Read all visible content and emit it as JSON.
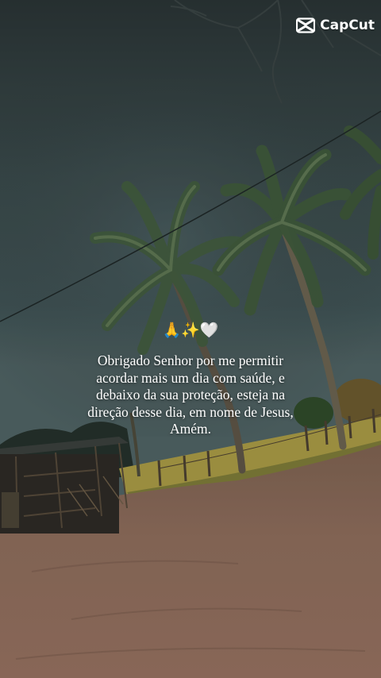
{
  "watermark": {
    "brand": "CapCut",
    "icon": "capcut-logo-icon"
  },
  "caption": {
    "emojis": "🙏✨🤍",
    "emoji_icons": [
      "praying-hands-icon",
      "sparkles-icon",
      "white-heart-icon"
    ],
    "text": "Obrigado Senhor por me permitir acordar mais um dia com saúde, e debaixo da sua proteção, esteja na direção desse dia, em nome de Jesus, Amém."
  },
  "colors": {
    "sky_top": "#2f3b3c",
    "sky_mid": "#3f5052",
    "ground": "#8a6a58",
    "palm": "#3d5a3a",
    "text": "#ffffff"
  }
}
